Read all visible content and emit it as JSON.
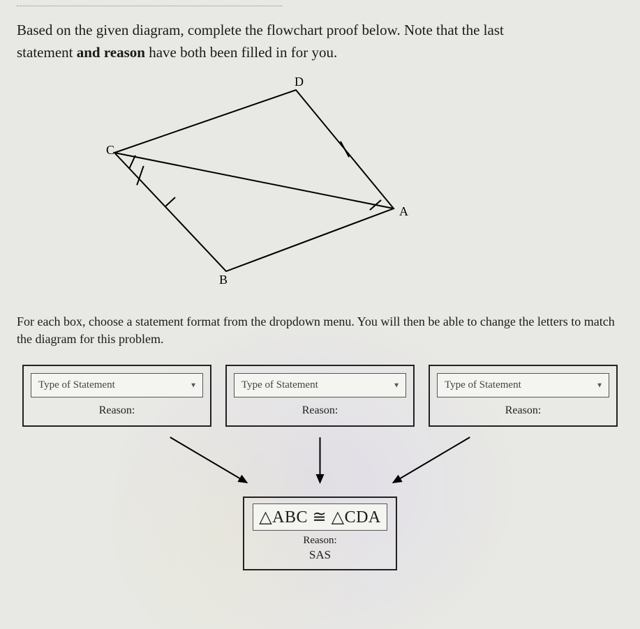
{
  "instructions": {
    "line1_a": "Based on the given diagram, complete the flowchart proof below. Note that the last",
    "line2_a": "statement ",
    "line2_b": "and reason",
    "line2_c": " have both been filled in for you."
  },
  "diagram": {
    "labels": {
      "A": "A",
      "B": "B",
      "C": "C",
      "D": "D"
    }
  },
  "sub_instructions": "For each box, choose a statement format from the dropdown menu. You will then be able to change the letters to match the diagram for this problem.",
  "boxes": [
    {
      "dropdown_placeholder": "Type of Statement",
      "reason_label": "Reason:"
    },
    {
      "dropdown_placeholder": "Type of Statement",
      "reason_label": "Reason:"
    },
    {
      "dropdown_placeholder": "Type of Statement",
      "reason_label": "Reason:"
    }
  ],
  "final": {
    "statement": "△ABC ≅ △CDA",
    "reason_label": "Reason:",
    "reason_value": "SAS"
  }
}
